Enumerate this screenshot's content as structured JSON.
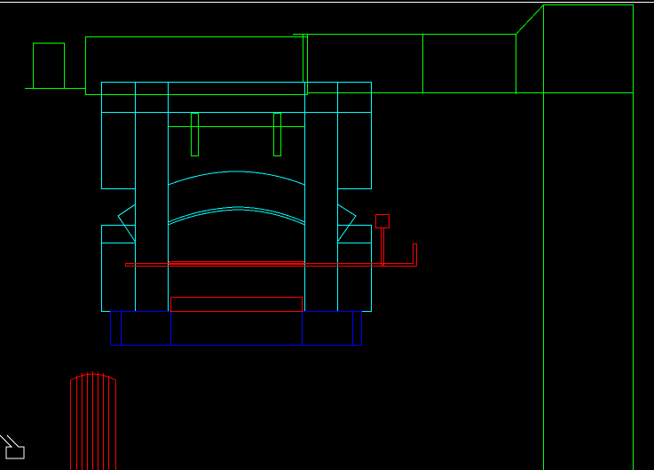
{
  "viewport": {
    "background": "#000000",
    "border_color": "#ffffff"
  },
  "layer_colors": {
    "duct": "#00ff00",
    "furnace": "#00ffff",
    "foundation": "#0000ff",
    "piping": "#ff0000"
  },
  "cursor": {
    "icon": "arrow-cursor-icon",
    "color": "#ffffff"
  }
}
